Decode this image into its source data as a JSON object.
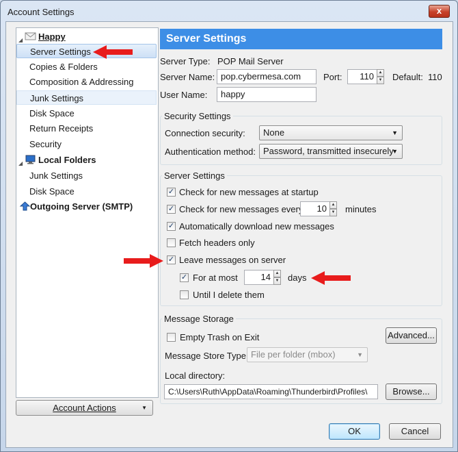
{
  "window": {
    "title": "Account Settings",
    "close_glyph": "x"
  },
  "tree": {
    "account_happy": "Happy",
    "happy_items": [
      "Server Settings",
      "Copies & Folders",
      "Composition & Addressing",
      "Junk Settings",
      "Disk Space",
      "Return Receipts",
      "Security"
    ],
    "local_folders": "Local Folders",
    "local_items": [
      "Junk Settings",
      "Disk Space"
    ],
    "outgoing": "Outgoing Server (SMTP)",
    "selected": "Server Settings"
  },
  "account_actions": {
    "label": "Account Actions",
    "dropdown_glyph": "▼"
  },
  "header": "Server Settings",
  "server": {
    "type_label": "Server Type:",
    "type_value": "POP Mail Server",
    "name_label": "Server Name:",
    "name_value": "pop.cybermesa.com",
    "port_label": "Port:",
    "port_value": "110",
    "default_label": "Default:",
    "default_value": "110",
    "user_label": "User Name:",
    "user_value": "happy"
  },
  "security": {
    "group_title": "Security Settings",
    "conn_label": "Connection security:",
    "conn_value": "None",
    "auth_label": "Authentication method:",
    "auth_value": "Password, transmitted insecurely"
  },
  "server_settings": {
    "group_title": "Server Settings",
    "check_startup": "Check for new messages at startup",
    "check_every": "Check for new messages every",
    "check_every_value": "10",
    "minutes": "minutes",
    "auto_download": "Automatically download new messages",
    "fetch_headers": "Fetch headers only",
    "leave_messages": "Leave messages on server",
    "for_at_most": "For at most",
    "days_value": "14",
    "days": "days",
    "until_delete": "Until I delete them"
  },
  "checkbox_state": {
    "check_startup": true,
    "check_every": true,
    "auto_download": true,
    "fetch_headers": false,
    "leave_messages": true,
    "for_at_most": true,
    "until_delete": false,
    "empty_trash": false
  },
  "storage": {
    "group_title": "Message Storage",
    "empty_trash": "Empty Trash on Exit",
    "advanced": "Advanced...",
    "store_type_label": "Message Store Type:",
    "store_type_value": "File per folder (mbox)",
    "local_dir_label": "Local directory:",
    "local_dir_value": "C:\\Users\\Ruth\\AppData\\Roaming\\Thunderbird\\Profiles\\",
    "browse": "Browse..."
  },
  "buttons": {
    "ok": "OK",
    "cancel": "Cancel"
  },
  "glyphs": {
    "check": "✓",
    "spin_up": "▲",
    "spin_down": "▼",
    "dropdown": "▼",
    "twisty": "◢"
  },
  "colors": {
    "header_bg": "#3d8ee6",
    "annotation_arrow": "#e81c1c"
  }
}
